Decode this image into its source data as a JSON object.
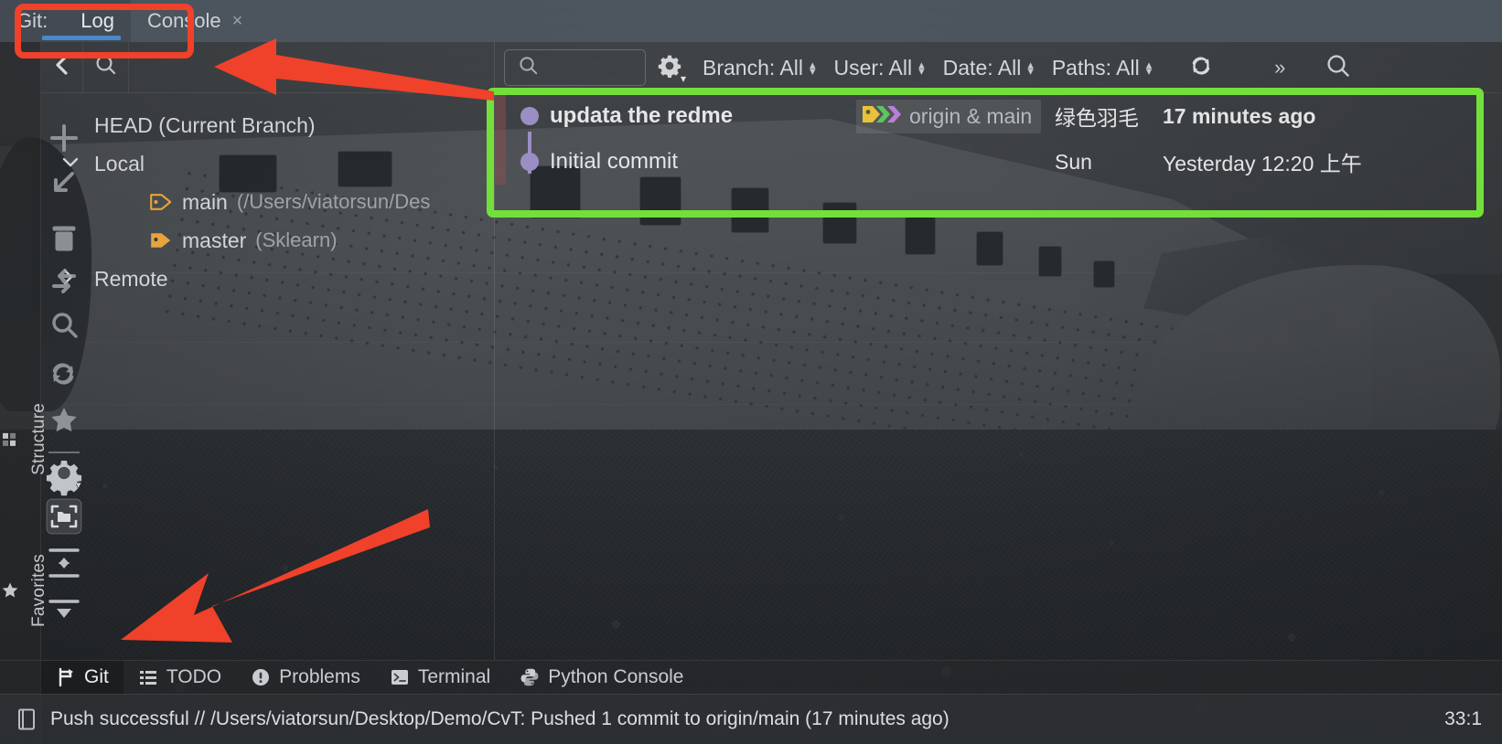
{
  "window": {
    "tabs": [
      {
        "label_prefix": "Git:",
        "label": "Log",
        "active": true,
        "closable": false
      },
      {
        "label_prefix": "",
        "label": "Console",
        "active": false,
        "closable": true,
        "close_glyph": "×"
      }
    ]
  },
  "left_rail": {
    "items": [
      {
        "name": "structure",
        "label": "Structure",
        "icon": "structure-icon"
      },
      {
        "name": "favorites",
        "label": "Favorites",
        "icon": "star-icon"
      }
    ]
  },
  "panel_toolbar": {
    "back_icon": "chevron-left-icon",
    "search_icon": "search-icon"
  },
  "branch_tree": {
    "nodes": [
      {
        "label": "HEAD (Current Branch)",
        "path": "",
        "level": 1,
        "arrow": "",
        "icon": ""
      },
      {
        "label": "Local",
        "path": "",
        "level": 1,
        "arrow": "⌄",
        "expanded": true,
        "icon": ""
      },
      {
        "label": "main",
        "path": "(/Users/viatorsun/Des",
        "level": 2,
        "arrow": "",
        "icon": "branch-tag-outline-icon"
      },
      {
        "label": "master",
        "path": "(Sklearn)",
        "level": 2,
        "arrow": "",
        "icon": "branch-tag-filled-icon"
      },
      {
        "label": "Remote",
        "path": "",
        "level": 1,
        "arrow": "›",
        "expanded": false,
        "icon": ""
      }
    ]
  },
  "log_toolbar": {
    "filter_placeholder": "",
    "filter_value": "",
    "search_icon": "search-icon",
    "settings_icon": "gear-icon",
    "filters": [
      {
        "name": "branch",
        "label": "Branch: All"
      },
      {
        "name": "user",
        "label": "User: All"
      },
      {
        "name": "date",
        "label": "Date: All"
      },
      {
        "name": "paths",
        "label": "Paths: All"
      }
    ],
    "refresh_icon": "refresh-icon",
    "overflow_label": "»",
    "find_icon": "search-icon"
  },
  "commits": [
    {
      "subject": "updata the redme",
      "bold": true,
      "refs_icon": "branch-labels-icon",
      "refs": "origin & main",
      "author": "绿色羽毛",
      "date": "17 minutes ago",
      "date_bold": true
    },
    {
      "subject": "Initial commit",
      "bold": false,
      "refs_icon": "",
      "refs": "",
      "author": "Sun",
      "date": "Yesterday 12:20 上午",
      "date_bold": false
    }
  ],
  "tool_window_tabs": [
    {
      "label": "Git",
      "icon": "git-branch-icon",
      "active": true
    },
    {
      "label": "TODO",
      "icon": "list-icon",
      "active": false
    },
    {
      "label": "Problems",
      "icon": "warning-circle-icon",
      "active": false
    },
    {
      "label": "Terminal",
      "icon": "terminal-icon",
      "active": false
    },
    {
      "label": "Python Console",
      "icon": "python-icon",
      "active": false
    }
  ],
  "status_bar": {
    "icon": "book-icon",
    "message": "Push successful // /Users/viatorsun/Desktop/Demo/CvT: Pushed 1 commit to origin/main (17 minutes ago)",
    "caret_position": "33:1"
  },
  "annotations": {
    "red_box_target": "git-log-tab",
    "green_box_target": "commit-list",
    "arrow_color": "#f0412a",
    "red_color": "#f0412a",
    "green_color": "#73e03a"
  }
}
